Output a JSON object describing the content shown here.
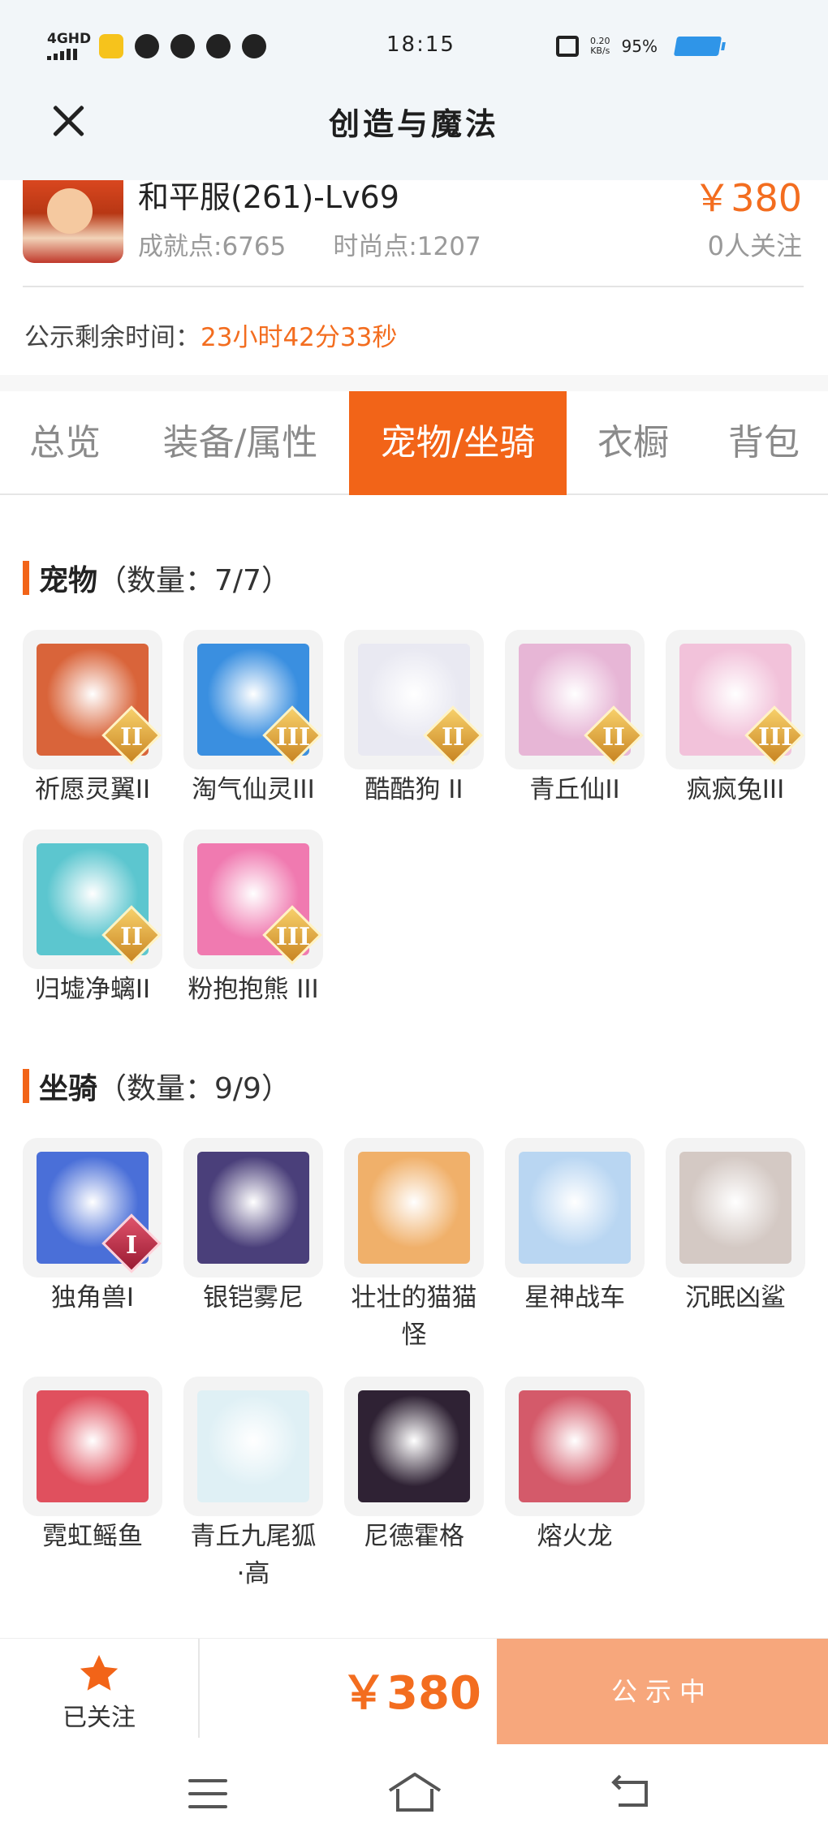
{
  "status_bar": {
    "network": "4GHD",
    "time": "18:15",
    "speed_top": "0.20",
    "speed_unit": "KB/s",
    "battery": "95%"
  },
  "header": {
    "title": "创造与魔法"
  },
  "role": {
    "name": "和平服(261)-Lv69",
    "achievement": "成就点:6765",
    "fashion": "时尚点:1207",
    "price": "￥380",
    "followers": "0人关注",
    "countdown_label": "公示剩余时间：",
    "countdown_value": "23小时42分33秒"
  },
  "tabs": [
    "总览",
    "装备/属性",
    "宠物/坐骑",
    "衣橱",
    "背包"
  ],
  "active_tab": 2,
  "pets": {
    "title": "宠物",
    "count": "（数量：7/7）",
    "items": [
      {
        "label": "祈愿灵翼II",
        "badge": "II",
        "color": "#d9643a"
      },
      {
        "label": "淘气仙灵III",
        "badge": "III",
        "color": "#3a8fe0"
      },
      {
        "label": "酷酷狗 II",
        "badge": "II",
        "color": "#e9e9f2"
      },
      {
        "label": "青丘仙II",
        "badge": "II",
        "color": "#e7b6d6"
      },
      {
        "label": "疯疯兔III",
        "badge": "III",
        "color": "#f2c2da"
      },
      {
        "label": "归墟净螭II",
        "badge": "II",
        "color": "#5cc6cf"
      },
      {
        "label": "粉抱抱熊 III",
        "badge": "III",
        "color": "#f07ab0"
      }
    ]
  },
  "mounts": {
    "title": "坐骑",
    "count": "（数量：9/9）",
    "items": [
      {
        "label": "独角兽I",
        "badge": "I",
        "color": "#4a6fd8"
      },
      {
        "label": "银铠雾尼",
        "badge": "",
        "color": "#4a3f7a"
      },
      {
        "label": "壮壮的猫猫怪",
        "badge": "",
        "color": "#f0b06a"
      },
      {
        "label": "星神战车",
        "badge": "",
        "color": "#b9d6f2"
      },
      {
        "label": "沉眠凶鲨",
        "badge": "",
        "color": "#d4c9c4"
      },
      {
        "label": "霓虹鳐鱼",
        "badge": "",
        "color": "#e0505e"
      },
      {
        "label": "青丘九尾狐·高",
        "badge": "",
        "color": "#dff0f5"
      },
      {
        "label": "尼德霍格",
        "badge": "",
        "color": "#2f2234"
      },
      {
        "label": "熔火龙",
        "badge": "",
        "color": "#d45a6a"
      }
    ]
  },
  "bottom_bar": {
    "follow_label": "已关注",
    "price": "￥380",
    "status_button": "公示中"
  },
  "colors": {
    "accent": "#f26418",
    "price": "#f36d1f",
    "status_btn": "#f7a77c"
  }
}
